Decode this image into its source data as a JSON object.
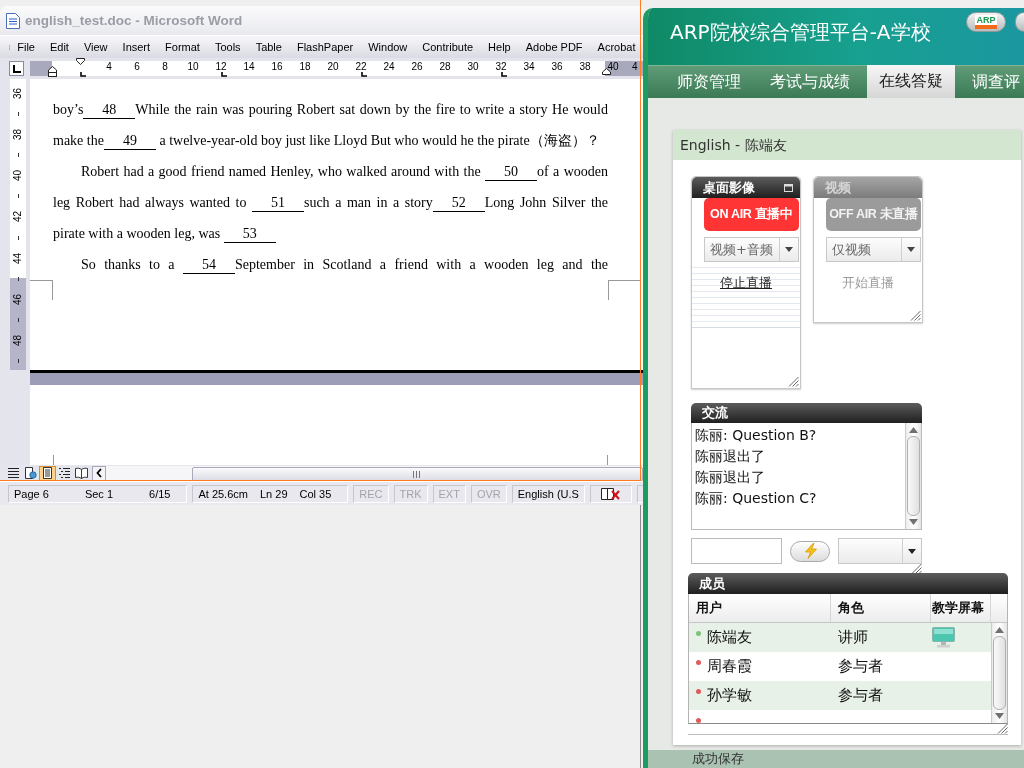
{
  "word": {
    "title": "english_test.doc - Microsoft Word",
    "menu": [
      "File",
      "Edit",
      "View",
      "Insert",
      "Format",
      "Tools",
      "Table",
      "FlashPaper",
      "Window",
      "Contribute",
      "Help",
      "Adobe PDF",
      "Acrobat"
    ],
    "ruler": [
      "4",
      "6",
      "8",
      "10",
      "12",
      "14",
      "16",
      "18",
      "20",
      "22",
      "24",
      "26",
      "28",
      "30",
      "32",
      "34",
      "36",
      "38",
      "40",
      "4"
    ],
    "vertical_ruler": [
      "36",
      "38",
      "40",
      "42",
      "44",
      "46",
      "48"
    ],
    "paragraphs": [
      {
        "indent": false,
        "ends": true,
        "lines": [
          [
            {
              "kind": "text",
              "text": "boy’s"
            },
            {
              "kind": "blank",
              "text": "48"
            },
            {
              "kind": "text",
              "text": "While the rain was pouring Robert sat down by the fire to write a story He would"
            }
          ],
          [
            {
              "kind": "text",
              "text": "make the"
            },
            {
              "kind": "blank",
              "text": "49"
            },
            {
              "kind": "text",
              "text": " a twelve-year-old boy just like Lloyd But who would he the pirate（海盗）？"
            }
          ]
        ]
      },
      {
        "indent": true,
        "ends": true,
        "lines": [
          [
            {
              "kind": "text",
              "text": "Robert had a good friend named Henley, who walked around with the "
            },
            {
              "kind": "blank",
              "text": "50"
            },
            {
              "kind": "text",
              "text": "of a wooden"
            }
          ],
          [
            {
              "kind": "text",
              "text": "leg Robert had always wanted to "
            },
            {
              "kind": "blank",
              "text": "51"
            },
            {
              "kind": "text",
              "text": "such a man in a story"
            },
            {
              "kind": "blank",
              "text": "52"
            },
            {
              "kind": "text",
              "text": "Long John Silver the"
            }
          ],
          [
            {
              "kind": "text",
              "text": "pirate with a wooden leg, was "
            },
            {
              "kind": "blank",
              "text": "53"
            }
          ]
        ]
      },
      {
        "indent": true,
        "ends": false,
        "lines": [
          [
            {
              "kind": "text",
              "text": "So thanks to a "
            },
            {
              "kind": "blank",
              "text": "54"
            },
            {
              "kind": "text",
              "text": "September in Scotland a friend with a wooden leg and the"
            }
          ]
        ]
      }
    ],
    "view_buttons": [
      {
        "kind": "normal",
        "selected": false
      },
      {
        "kind": "web",
        "selected": false
      },
      {
        "kind": "print",
        "selected": true
      },
      {
        "kind": "outline",
        "selected": false
      },
      {
        "kind": "reading",
        "selected": false
      }
    ],
    "status_bar": [
      {
        "kind": "text",
        "items": [
          {
            "text": "Page 6",
            "disabled": false
          },
          {
            "text": "Sec 1",
            "disabled": false
          },
          {
            "text": "6/15",
            "disabled": false
          }
        ]
      },
      {
        "kind": "text",
        "items": [
          {
            "text": "At 25.6cm",
            "disabled": false
          },
          {
            "text": "Ln 29",
            "disabled": false
          },
          {
            "text": "Col 35",
            "disabled": false
          }
        ]
      },
      {
        "kind": "text",
        "items": [
          {
            "text": "REC",
            "disabled": true
          }
        ]
      },
      {
        "kind": "text",
        "items": [
          {
            "text": "TRK",
            "disabled": true
          }
        ]
      },
      {
        "kind": "text",
        "items": [
          {
            "text": "EXT",
            "disabled": true
          }
        ]
      },
      {
        "kind": "text",
        "items": [
          {
            "text": "OVR",
            "disabled": true
          }
        ]
      },
      {
        "kind": "text",
        "items": [
          {
            "text": "English (U.S",
            "disabled": false
          }
        ]
      },
      {
        "kind": "spelling"
      },
      {
        "kind": "empty"
      }
    ]
  },
  "arp": {
    "title": "ARP院校综合管理平台-A学校",
    "logo": "ARP",
    "tabs": [
      {
        "label": "师资管理",
        "selected": false
      },
      {
        "label": "考试与成绩",
        "selected": false
      },
      {
        "label": "在线答疑",
        "selected": true
      },
      {
        "label": "调查评",
        "selected": false
      }
    ],
    "course": "English - 陈端友",
    "broadcasts": [
      {
        "title": "桌面影像",
        "live": true,
        "status": "ON AIR 直播中",
        "source": "视频+音频",
        "action": "停止直播"
      },
      {
        "title": "视频",
        "live": false,
        "status": "OFF AIR 未直播",
        "source": "仅视频",
        "action": "开始直播"
      }
    ],
    "chat": {
      "title": "交流",
      "messages": [
        "陈丽: Question B?",
        "陈丽退出了",
        "陈丽退出了",
        "陈丽: Question C?"
      ]
    },
    "members": {
      "title": "成员",
      "columns": [
        "用户",
        "角色",
        "教学屏幕"
      ],
      "rows": [
        {
          "name": "陈端友",
          "role": "讲师",
          "color": "#7cc47c",
          "screen": true
        },
        {
          "name": "周春霞",
          "role": "参与者",
          "color": "#e05a5a",
          "screen": false
        },
        {
          "name": "孙学敏",
          "role": "参与者",
          "color": "#e05a5a",
          "screen": false
        },
        {
          "color": "#e05a5a",
          "screen": false
        }
      ]
    },
    "status_message": "成功保存"
  }
}
